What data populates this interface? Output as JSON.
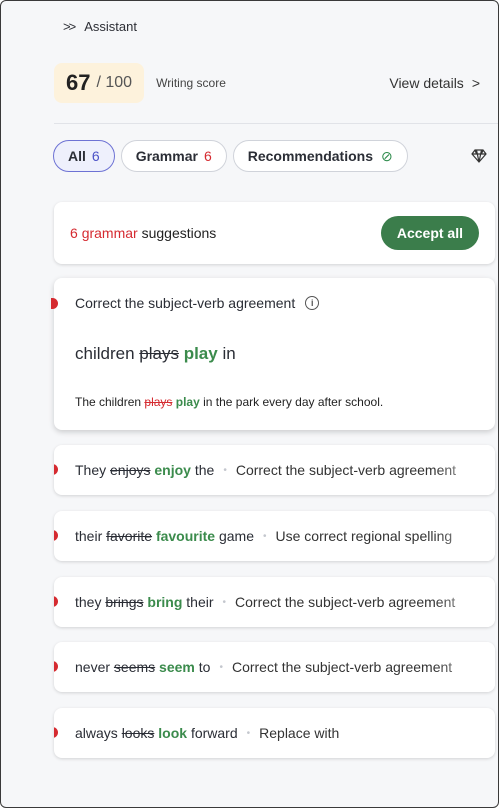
{
  "header": {
    "chevron": ">>",
    "title": "Assistant"
  },
  "score": {
    "value": "67",
    "max": "/ 100",
    "label": "Writing score",
    "view_details": "View details",
    "arrow": ">"
  },
  "tabs": [
    {
      "label": "All",
      "count": "6"
    },
    {
      "label": "Grammar",
      "count": "6"
    },
    {
      "label": "Recommendations",
      "icon": "check-circle-icon",
      "glyph": "⊘"
    }
  ],
  "premium_icon": "◇",
  "summary": {
    "count": "6",
    "word": "grammar",
    "rest": " suggestions",
    "accept_all": "Accept all"
  },
  "expanded": {
    "title": "Correct the subject-verb agreement",
    "info": "i",
    "phrase": {
      "before": "children",
      "removed": "plays",
      "added": "play",
      "after": "in"
    },
    "sentence": {
      "before": "The children",
      "removed": "plays",
      "added": "play",
      "after": "in the park every day after school."
    }
  },
  "suggestions": [
    {
      "before": "They",
      "removed": "enjoys",
      "added": "enjoy",
      "after": "the",
      "desc": "Correct the subject-verb agreement"
    },
    {
      "before": "their",
      "removed": "favorite",
      "added": "favourite",
      "after": "game",
      "desc": "Use correct regional spelling"
    },
    {
      "before": "they",
      "removed": "brings",
      "added": "bring",
      "after": "their",
      "desc": "Correct the subject-verb agreement"
    },
    {
      "before": "never",
      "removed": "seems",
      "added": "seem",
      "after": "to",
      "desc": "Correct the subject-verb agreement"
    },
    {
      "before": "always",
      "removed": "looks",
      "added": "look",
      "after": "forward",
      "desc": "Replace with"
    }
  ],
  "separator": "•",
  "colors": {
    "accent": "#4b51c7",
    "error": "#d52a30",
    "success": "#3b7d4b",
    "score_bg": "#fdf2dc"
  }
}
